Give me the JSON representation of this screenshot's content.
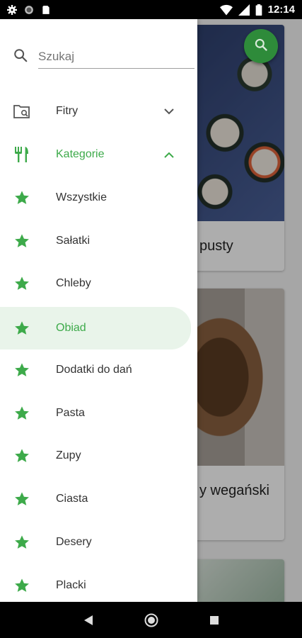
{
  "status_bar": {
    "time": "12:14"
  },
  "search": {
    "placeholder": "Szukaj"
  },
  "drawer": {
    "filters_label": "Fitry",
    "categories_label": "Kategorie",
    "categories": [
      {
        "label": "Wszystkie"
      },
      {
        "label": "Sałatki"
      },
      {
        "label": "Chleby"
      },
      {
        "label": "Obiad",
        "selected": true
      },
      {
        "label": "Dodatki do dań"
      },
      {
        "label": "Pasta"
      },
      {
        "label": "Zupy"
      },
      {
        "label": "Ciasta"
      },
      {
        "label": "Desery"
      },
      {
        "label": "Placki"
      }
    ]
  },
  "background_cards": [
    {
      "title_visible": "pusty"
    },
    {
      "title_visible": "y wegański"
    }
  ],
  "colors": {
    "accent": "#3daa4a",
    "fab": "#2e8b3a",
    "selected_bg": "#e9f4ea"
  }
}
